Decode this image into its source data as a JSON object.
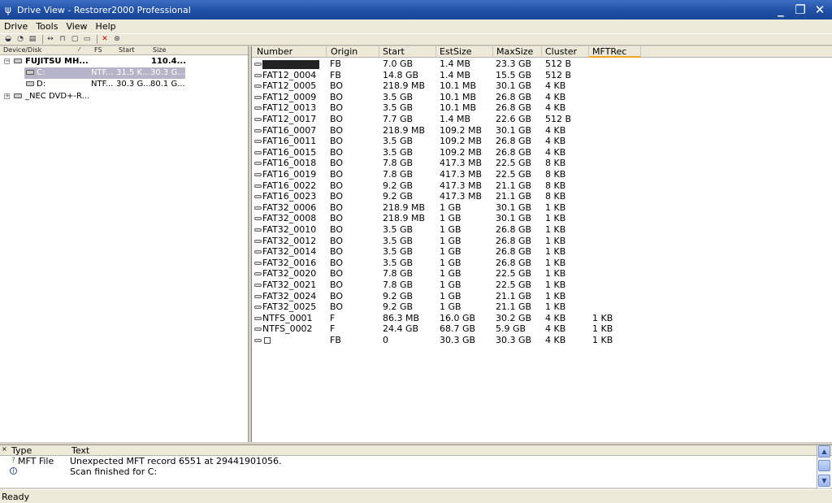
{
  "window": {
    "title": "Drive View - Restorer2000 Professional"
  },
  "menu": [
    "Drive",
    "Tools",
    "View",
    "Help"
  ],
  "left": {
    "headers": {
      "device": "Device/Disk",
      "fs": "FS",
      "start": "Start",
      "size": "Size"
    },
    "tree": [
      {
        "name": "FUJITSU MH...",
        "fs": "",
        "start": "",
        "size": "110.4..."
      },
      {
        "name": "C:",
        "fs": "NTF...",
        "start": "31.5 K...",
        "size": "30.3 G..."
      },
      {
        "name": "D:",
        "fs": "NTF...",
        "start": "30.3 G...",
        "size": "80.1 G..."
      },
      {
        "name": "_NEC DVD+-R...",
        "fs": "",
        "start": "",
        "size": ""
      }
    ]
  },
  "grid": {
    "headers": [
      "Number",
      "Origin",
      "Start",
      "EstSize",
      "MaxSize",
      "Cluster",
      "MFTRec"
    ],
    "rows": [
      [
        "",
        "FB",
        "7.0 GB",
        "1.4 MB",
        "23.3 GB",
        "512 B",
        ""
      ],
      [
        "FAT12_0004",
        "FB",
        "14.8 GB",
        "1.4 MB",
        "15.5 GB",
        "512 B",
        ""
      ],
      [
        "FAT12_0005",
        "BO",
        "218.9 MB",
        "10.1 MB",
        "30.1 GB",
        "4 KB",
        ""
      ],
      [
        "FAT12_0009",
        "BO",
        "3.5 GB",
        "10.1 MB",
        "26.8 GB",
        "4 KB",
        ""
      ],
      [
        "FAT12_0013",
        "BO",
        "3.5 GB",
        "10.1 MB",
        "26.8 GB",
        "4 KB",
        ""
      ],
      [
        "FAT12_0017",
        "BO",
        "7.7 GB",
        "1.4 MB",
        "22.6 GB",
        "512 B",
        ""
      ],
      [
        "FAT16_0007",
        "BO",
        "218.9 MB",
        "109.2 MB",
        "30.1 GB",
        "4 KB",
        ""
      ],
      [
        "FAT16_0011",
        "BO",
        "3.5 GB",
        "109.2 MB",
        "26.8 GB",
        "4 KB",
        ""
      ],
      [
        "FAT16_0015",
        "BO",
        "3.5 GB",
        "109.2 MB",
        "26.8 GB",
        "4 KB",
        ""
      ],
      [
        "FAT16_0018",
        "BO",
        "7.8 GB",
        "417.3 MB",
        "22.5 GB",
        "8 KB",
        ""
      ],
      [
        "FAT16_0019",
        "BO",
        "7.8 GB",
        "417.3 MB",
        "22.5 GB",
        "8 KB",
        ""
      ],
      [
        "FAT16_0022",
        "BO",
        "9.2 GB",
        "417.3 MB",
        "21.1 GB",
        "8 KB",
        ""
      ],
      [
        "FAT16_0023",
        "BO",
        "9.2 GB",
        "417.3 MB",
        "21.1 GB",
        "8 KB",
        ""
      ],
      [
        "FAT32_0006",
        "BO",
        "218.9 MB",
        "1 GB",
        "30.1 GB",
        "1 KB",
        ""
      ],
      [
        "FAT32_0008",
        "BO",
        "218.9 MB",
        "1 GB",
        "30.1 GB",
        "1 KB",
        ""
      ],
      [
        "FAT32_0010",
        "BO",
        "3.5 GB",
        "1 GB",
        "26.8 GB",
        "1 KB",
        ""
      ],
      [
        "FAT32_0012",
        "BO",
        "3.5 GB",
        "1 GB",
        "26.8 GB",
        "1 KB",
        ""
      ],
      [
        "FAT32_0014",
        "BO",
        "3.5 GB",
        "1 GB",
        "26.8 GB",
        "1 KB",
        ""
      ],
      [
        "FAT32_0016",
        "BO",
        "3.5 GB",
        "1 GB",
        "26.8 GB",
        "1 KB",
        ""
      ],
      [
        "FAT32_0020",
        "BO",
        "7.8 GB",
        "1 GB",
        "22.5 GB",
        "1 KB",
        ""
      ],
      [
        "FAT32_0021",
        "BO",
        "7.8 GB",
        "1 GB",
        "22.5 GB",
        "1 KB",
        ""
      ],
      [
        "FAT32_0024",
        "BO",
        "9.2 GB",
        "1 GB",
        "21.1 GB",
        "1 KB",
        ""
      ],
      [
        "FAT32_0025",
        "BO",
        "9.2 GB",
        "1 GB",
        "21.1 GB",
        "1 KB",
        ""
      ],
      [
        "NTFS_0001",
        "F",
        "86.3 MB",
        "16.0 GB",
        "30.2 GB",
        "4 KB",
        "1 KB"
      ],
      [
        "NTFS_0002",
        "F",
        "24.4 GB",
        "68.7 GB",
        "5.9 GB",
        "4 KB",
        "1 KB"
      ],
      [
        "",
        "FB",
        "0",
        "30.3 GB",
        "30.3 GB",
        "4 KB",
        "1 KB"
      ]
    ]
  },
  "log": {
    "headers": {
      "type": "Type",
      "text": "Text"
    },
    "rows": [
      {
        "icon": "?",
        "type": "MFT File",
        "text": "Unexpected MFT record 6551 at 29441901056."
      },
      {
        "icon": "i",
        "type": "",
        "text": "Scan finished for C:"
      }
    ]
  },
  "status": "Ready"
}
